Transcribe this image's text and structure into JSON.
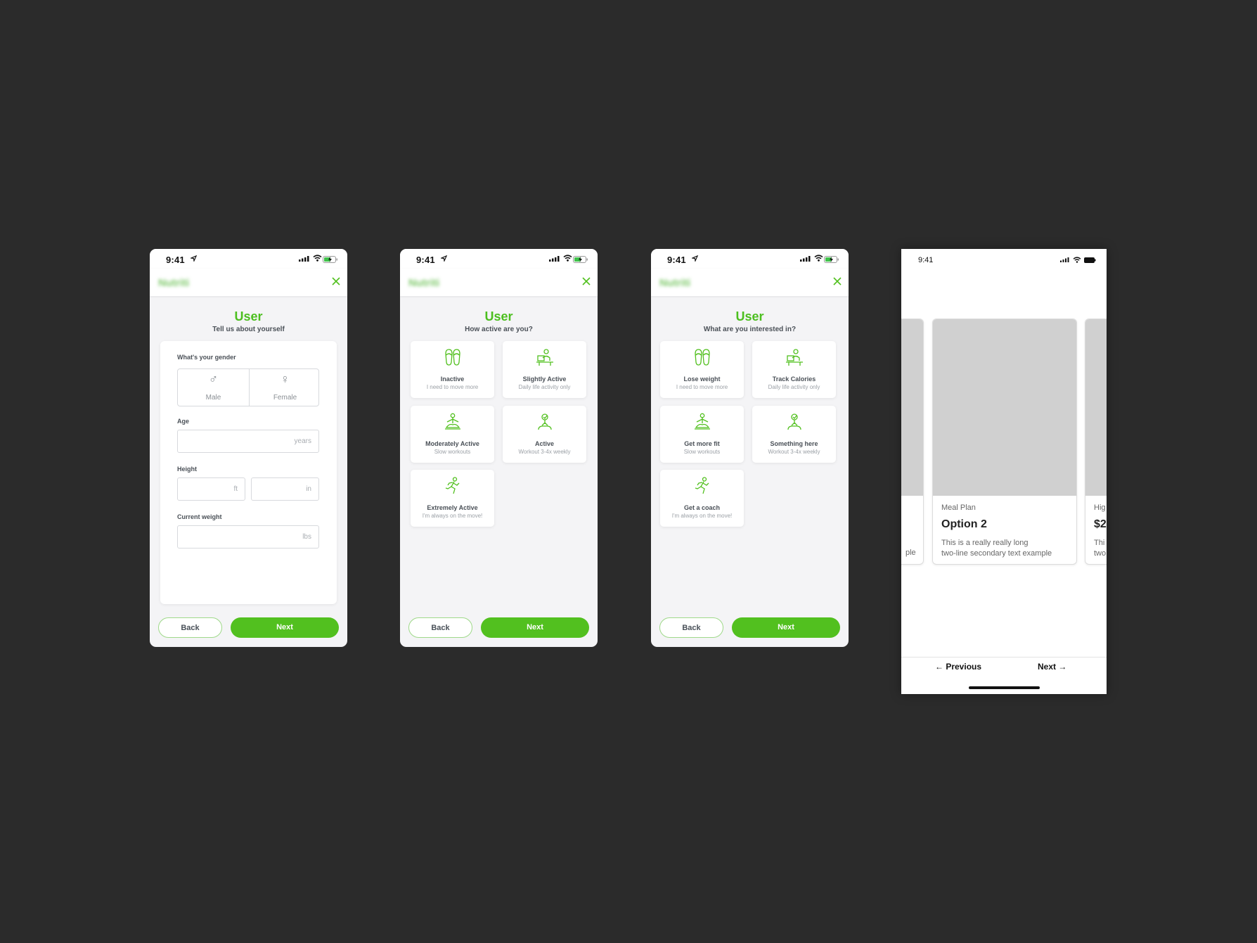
{
  "status": {
    "time": "9:41"
  },
  "brand": {
    "logo": "Nutriti",
    "accent": "#52c01f"
  },
  "buttons": {
    "back": "Back",
    "next": "Next"
  },
  "screen1": {
    "title": "User",
    "subtitle": "Tell us about yourself",
    "gender_label": "What's your gender",
    "gender_options": [
      {
        "label": "Male",
        "icon": "male-icon"
      },
      {
        "label": "Female",
        "icon": "female-icon"
      }
    ],
    "age_label": "Age",
    "age_unit": "years",
    "height_label": "Height",
    "height_unit_ft": "ft",
    "height_unit_in": "in",
    "weight_label": "Current weight",
    "weight_unit": "lbs"
  },
  "screen2": {
    "title": "User",
    "subtitle": "How active are you?",
    "options": [
      {
        "label": "Inactive",
        "sub": "I need to move more",
        "icon": "slippers-icon"
      },
      {
        "label": "Slightly Active",
        "sub": "Daily life activity only",
        "icon": "desk-worker-icon"
      },
      {
        "label": "Moderately Active",
        "sub": "Slow workouts",
        "icon": "yoga-icon"
      },
      {
        "label": "Active",
        "sub": "Workout 3-4x weekly",
        "icon": "trainer-icon"
      },
      {
        "label": "Extremely Active",
        "sub": "I'm always on the move!",
        "icon": "runner-icon"
      }
    ]
  },
  "screen3": {
    "title": "User",
    "subtitle": "What are you interested in?",
    "options": [
      {
        "label": "Lose weight",
        "sub": "I need to move more",
        "icon": "slippers-icon"
      },
      {
        "label": "Track Calories",
        "sub": "Daily life activity only",
        "icon": "desk-worker-icon"
      },
      {
        "label": "Get more fit",
        "sub": "Slow workouts",
        "icon": "yoga-icon"
      },
      {
        "label": "Something here",
        "sub": "Workout 3-4x weekly",
        "icon": "trainer-icon"
      },
      {
        "label": "Get a coach",
        "sub": "I'm always on the move!",
        "icon": "runner-icon"
      }
    ]
  },
  "screen4": {
    "time": "9:41",
    "left_card": {
      "body_tail": "ple"
    },
    "center_card": {
      "eyebrow": "Meal Plan",
      "title": "Option 2",
      "body_line1": "This is a really really long",
      "body_line2": "two-line secondary text example"
    },
    "right_card": {
      "eyebrow": "Hig",
      "title": "$2",
      "body_line1": "Thi",
      "body_line2": "two"
    },
    "nav": {
      "previous": "← Previous",
      "next": "Next →"
    }
  }
}
